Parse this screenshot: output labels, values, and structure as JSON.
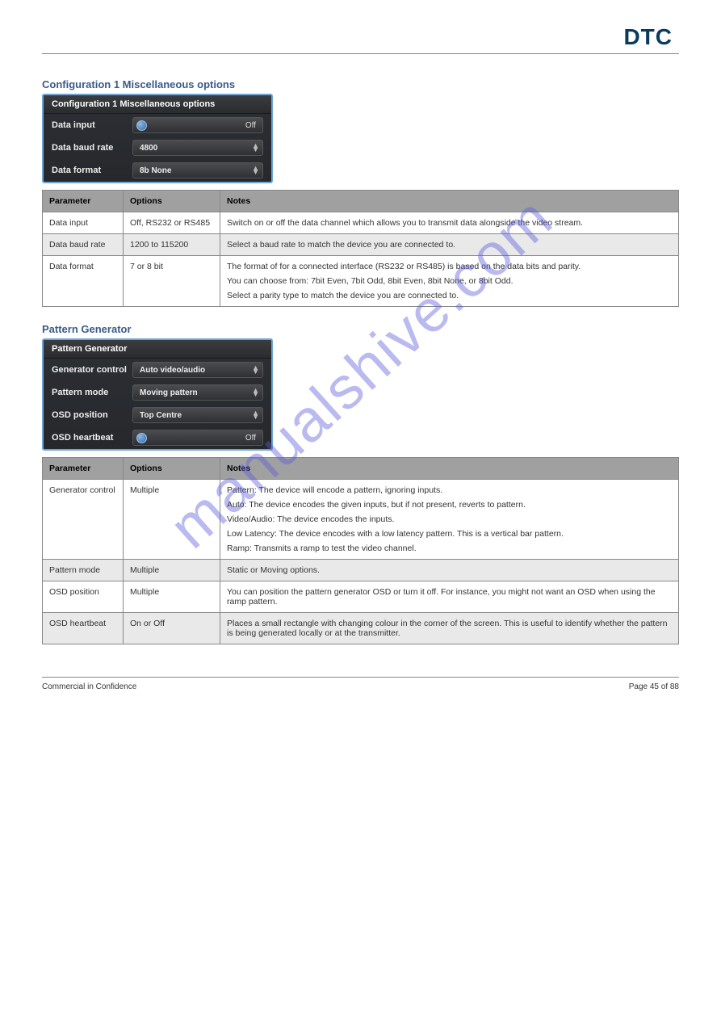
{
  "logo": "DTC",
  "watermark": "manualshive.com",
  "section1": {
    "title": "Configuration 1 Miscellaneous options",
    "panel_title": "Configuration 1 Miscellaneous options",
    "rows": {
      "data_input": {
        "label": "Data input",
        "value": "Off"
      },
      "baud": {
        "label": "Data baud rate",
        "value": "4800"
      },
      "format": {
        "label": "Data format",
        "value": "8b None"
      }
    }
  },
  "table1": {
    "headers": [
      "Parameter",
      "Options",
      "Notes"
    ],
    "rows": [
      {
        "p": "Data input",
        "o": "Off, RS232 or RS485",
        "n": [
          "Switch on or off the data channel which allows you to transmit data alongside the video stream."
        ]
      },
      {
        "p": "Data baud rate",
        "o": "1200 to 115200",
        "n": [
          "Select a baud rate to match the device you are connected to."
        ],
        "shade": true
      },
      {
        "p": "Data format",
        "o": "7 or 8 bit",
        "n": [
          "The format of for a connected interface (RS232 or RS485) is based on the data bits and parity.",
          "You can choose from: 7bit Even, 7bit Odd, 8bit Even, 8bit None, or 8bit Odd.",
          "Select a parity type to match the device you are connected to."
        ]
      }
    ]
  },
  "section2": {
    "title": "Pattern Generator",
    "panel_title": "Pattern Generator",
    "rows": {
      "gen": {
        "label": "Generator control",
        "value": "Auto video/audio"
      },
      "pattern": {
        "label": "Pattern mode",
        "value": "Moving pattern"
      },
      "osd_pos": {
        "label": "OSD position",
        "value": "Top Centre"
      },
      "osd_hb": {
        "label": "OSD heartbeat",
        "value": "Off"
      }
    }
  },
  "table2": {
    "headers": [
      "Parameter",
      "Options",
      "Notes"
    ],
    "rows": [
      {
        "p": "Generator control",
        "o": "Multiple",
        "n": [
          "Pattern: The device will encode a pattern, ignoring inputs.",
          "Auto: The device encodes the given inputs, but if not present, reverts to pattern.",
          "Video/Audio: The device encodes the inputs.",
          "Low Latency: The device encodes with a low latency pattern. This is a vertical bar pattern.",
          "Ramp: Transmits a ramp to test the video channel."
        ]
      },
      {
        "p": "Pattern mode",
        "o": "Multiple",
        "n": [
          "Static or Moving options."
        ],
        "shade": true
      },
      {
        "p": "OSD position",
        "o": "Multiple",
        "n": [
          "You can position the pattern generator OSD or turn it off. For instance, you might not want an OSD when using the ramp pattern."
        ]
      },
      {
        "p": "OSD heartbeat",
        "o": "On or Off",
        "n": [
          "Places a small rectangle with changing colour in the corner of the screen. This is useful to identify whether the pattern is being generated locally or at the transmitter."
        ],
        "shade": true
      }
    ]
  },
  "footer": {
    "left": "Commercial in Confidence",
    "right": "Page 45 of 88"
  }
}
